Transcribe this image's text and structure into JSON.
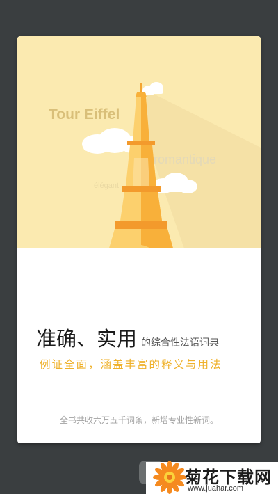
{
  "hero": {
    "word_main": "Tour Eiffel",
    "word_secondary": "romantique",
    "word_small": "élégant"
  },
  "content": {
    "title": "准确、实用",
    "subtitle": "的综合性法语词典",
    "tagline": "例证全面，涵盖丰富的释义与用法",
    "footnote": "全书共收六万五千词条，新增专业性新词。"
  },
  "watermark": {
    "name": "菊花下载网",
    "url": "www.juahar.com"
  },
  "colors": {
    "background": "#3a3e40",
    "hero_bg": "#fbeab0",
    "tower_main": "#f8b03a",
    "tower_light": "#fcd06d",
    "tagline": "#efb12b"
  }
}
